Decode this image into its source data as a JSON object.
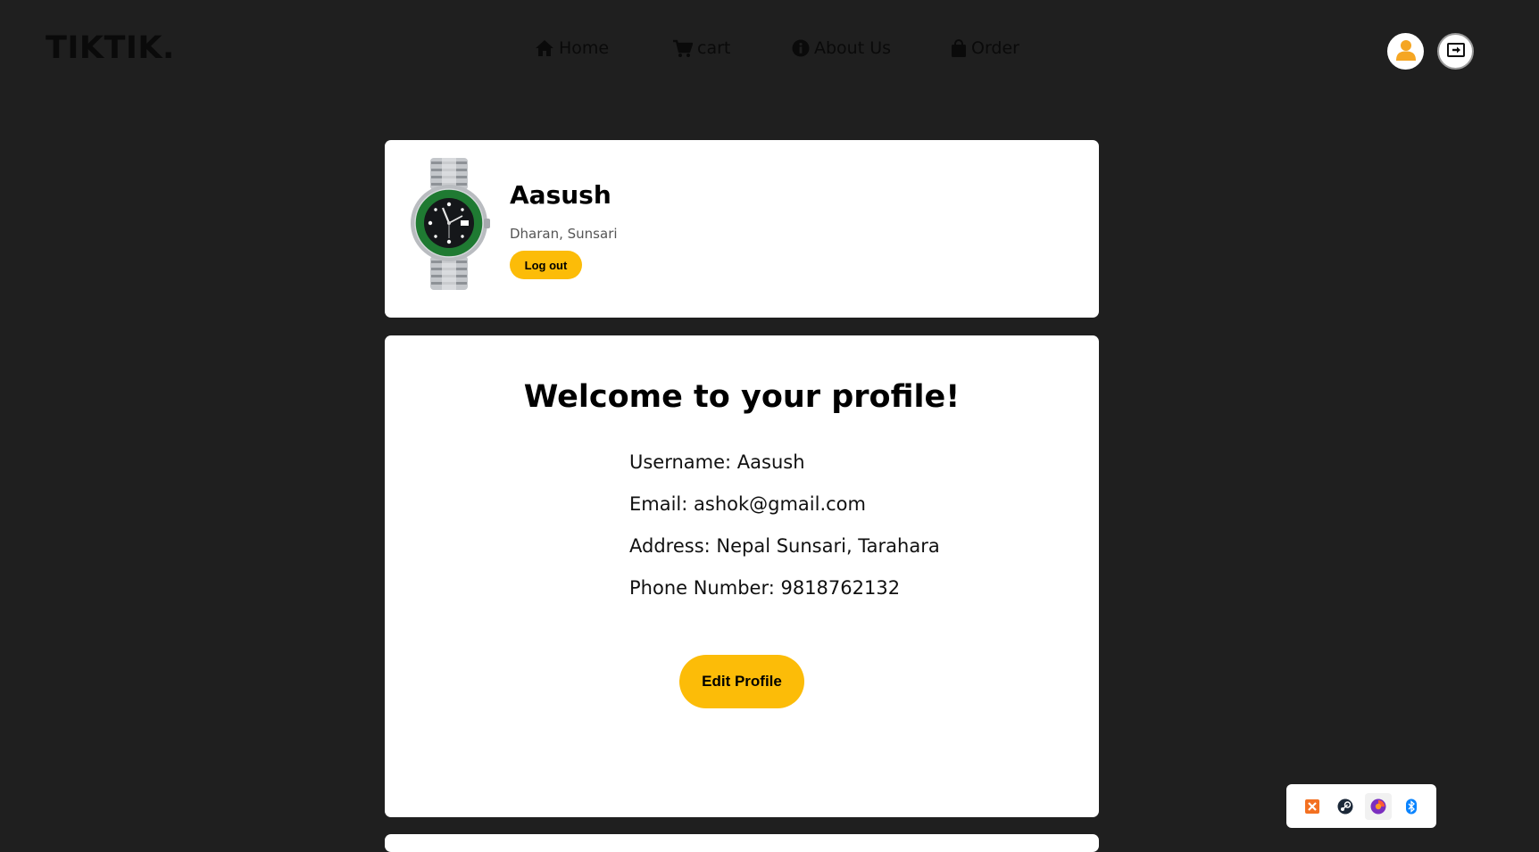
{
  "header": {
    "logo": "TIKTIK.",
    "nav": [
      {
        "label": "Home",
        "icon": "home-icon"
      },
      {
        "label": "cart",
        "icon": "cart-icon"
      },
      {
        "label": "About Us",
        "icon": "info-icon"
      },
      {
        "label": "Order",
        "icon": "bag-icon"
      }
    ],
    "right_icons": [
      "user-icon",
      "logout-icon"
    ]
  },
  "profile_card": {
    "name": "Aasush",
    "location": "Dharan, Sunsari",
    "logout_label": "Log out",
    "avatar": "watch-image"
  },
  "main_card": {
    "heading": "Welcome to your profile!",
    "username": "Username: Aasush",
    "email": "Email: ashok@gmail.com",
    "address": "Address: Nepal Sunsari, Tarahara",
    "phone": "Phone Number: 9818762132",
    "edit_label": "Edit Profile"
  },
  "tray": {
    "icons": [
      "xampp-icon",
      "steam-icon",
      "browser-icon",
      "bluetooth-icon"
    ]
  },
  "colors": {
    "background": "#1f1f1f",
    "card": "#ffffff",
    "accent": "#fcbc08",
    "user_icon": "#f5a623",
    "watch_bezel": "#1f7a32"
  }
}
